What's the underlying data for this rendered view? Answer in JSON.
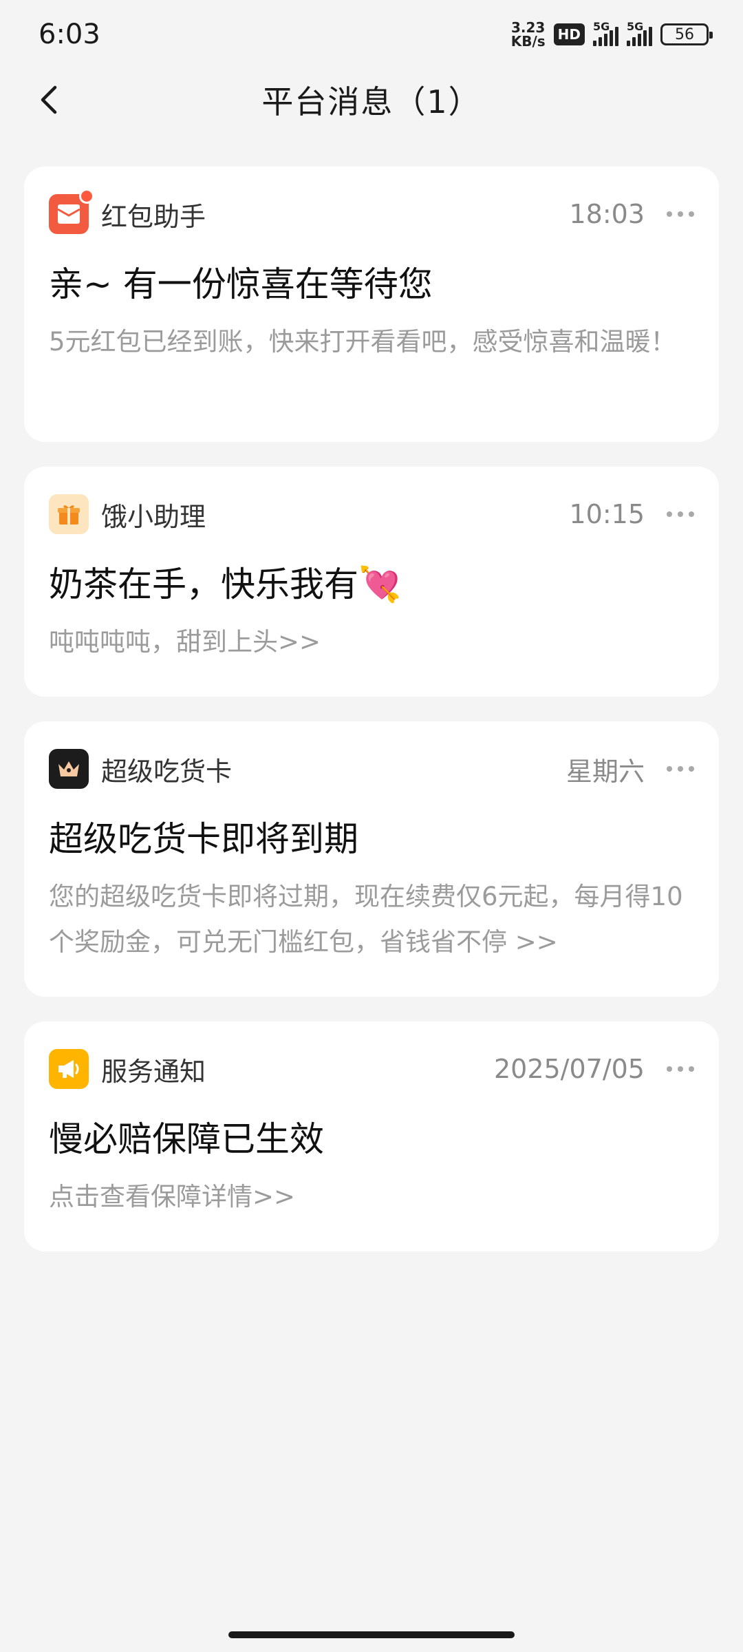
{
  "status_bar": {
    "time": "6:03",
    "net_speed_value": "3.23",
    "net_speed_unit": "KB/s",
    "hd_label": "HD",
    "signal1_label": "5G",
    "signal2_label": "5G",
    "battery": "56"
  },
  "header": {
    "title": "平台消息（1）"
  },
  "messages": [
    {
      "source": "红包助手",
      "time": "18:03",
      "title": "亲~ 有一份惊喜在等待您",
      "body": "5元红包已经到账，快来打开看看吧，感受惊喜和温暖！",
      "icon": "red-envelope-icon",
      "icon_color": "#f25b3f",
      "unread": true
    },
    {
      "source": "饿小助理",
      "time": "10:15",
      "title": "奶茶在手，快乐我有💘",
      "body": "吨吨吨吨，甜到上头>>",
      "icon": "gift-icon",
      "icon_color": "#fde5bf"
    },
    {
      "source": "超级吃货卡",
      "time": "星期六",
      "title": "超级吃货卡即将到期",
      "body": "您的超级吃货卡即将过期，现在续费仅6元起，每月得10个奖励金，可兑无门槛红包，省钱省不停 >>",
      "icon": "crown-icon",
      "icon_color": "#1c1c1c"
    },
    {
      "source": "服务通知",
      "time": "2025/07/05",
      "title": "慢必赔保障已生效",
      "body": "点击查看保障详情>>",
      "icon": "megaphone-icon",
      "icon_color": "#ffb400"
    }
  ]
}
